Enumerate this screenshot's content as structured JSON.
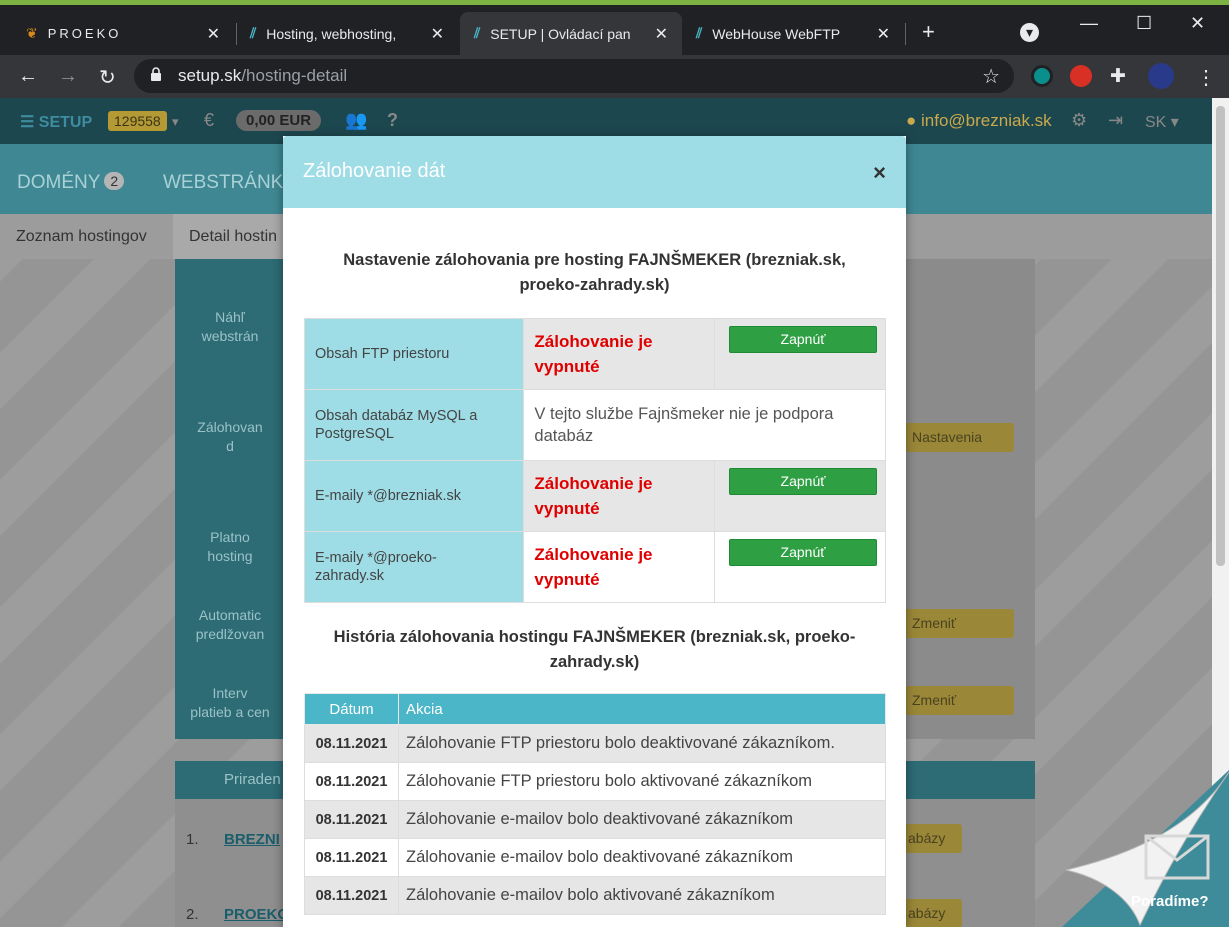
{
  "browser": {
    "tabs": [
      {
        "title": "PROEKO",
        "active": false
      },
      {
        "title": "Hosting, webhosting,",
        "active": false
      },
      {
        "title": "SETUP | Ovládací pan",
        "active": true
      },
      {
        "title": "WebHouse WebFTP",
        "active": false
      }
    ],
    "url_host": "setup.sk",
    "url_path": "/hosting-detail",
    "accent_color": "#7cb342"
  },
  "setupbar": {
    "logo": "SETUP",
    "account_id": "129558",
    "currency_symbol": "€",
    "balance": "0,00 EUR",
    "email": "info@brezniak.sk",
    "lang": "SK"
  },
  "mainnav": {
    "domains_label": "DOMÉNY",
    "domains_count": "2",
    "websites_label": "WEBSTRÁNKY"
  },
  "subnav": {
    "list_label": "Zoznam hostingov",
    "detail_label": "Detail hostin"
  },
  "background_rows": {
    "r1": [
      "Náhľ",
      "webstrán"
    ],
    "r2": [
      "Zálohovan",
      "d"
    ],
    "r3": [
      "Platno",
      "hosting"
    ],
    "r4": [
      "Automatic",
      "predlžovan"
    ],
    "r5": [
      "Interv",
      "platieb a cen"
    ],
    "btn_settings": "Nastavenia",
    "btn_change1": "Zmeniť",
    "btn_change2": "Zmeniť",
    "t2_header": "Priraden",
    "t2_row1_num": "1.",
    "t2_row1_link": "BREZNI",
    "t2_row1_btn": "abázy",
    "t2_row2_num": "2.",
    "t2_row2_link": "PROEKO",
    "t2_row2_btn": "abázy"
  },
  "modal": {
    "title": "Zálohovanie dát",
    "close": "×",
    "settings_heading_1": "Nastavenie zálohovania pre hosting FAJNŠMEKER (brezniak.sk,",
    "settings_heading_2": "proeko-zahrady.sk)",
    "settings": [
      {
        "label": "Obsah FTP priestoru",
        "status_1": "Zálohovanie je",
        "status_2": "vypnuté",
        "button": "Zapnúť"
      },
      {
        "label_1": "Obsah databáz MySQL a",
        "label_2": "PostgreSQL",
        "info_1": "V tejto službe Fajnšmeker nie je podpora",
        "info_2": "databáz"
      },
      {
        "label": "E-maily *@brezniak.sk",
        "status_1": "Zálohovanie je",
        "status_2": "vypnuté",
        "button": "Zapnúť"
      },
      {
        "label_1": "E-maily *@proeko-",
        "label_2": "zahrady.sk",
        "status_1": "Zálohovanie je",
        "status_2": "vypnuté",
        "button": "Zapnúť"
      }
    ],
    "history_heading_1": "História zálohovania hostingu FAJNŠMEKER (brezniak.sk, proeko-",
    "history_heading_2": "zahrady.sk)",
    "history_columns": {
      "date": "Dátum",
      "action": "Akcia"
    },
    "history": [
      {
        "date": "08.11.2021",
        "action": "Zálohovanie FTP priestoru bolo deaktivované zákazníkom."
      },
      {
        "date": "08.11.2021",
        "action": "Zálohovanie FTP priestoru bolo aktivované zákazníkom"
      },
      {
        "date": "08.11.2021",
        "action": "Zálohovanie e-mailov bolo deaktivované zákazníkom"
      },
      {
        "date": "08.11.2021",
        "action": "Zálohovanie e-mailov bolo deaktivované zákazníkom"
      },
      {
        "date": "08.11.2021",
        "action": "Zálohovanie e-mailov bolo aktivované zákazníkom"
      }
    ]
  },
  "help_corner": {
    "label": "Poradíme?"
  }
}
